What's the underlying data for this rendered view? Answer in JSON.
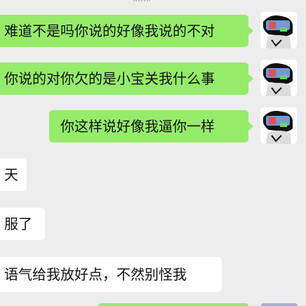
{
  "conversation": {
    "messages": [
      {
        "side": "out",
        "text": "难道不是吗你说的好像我说的不对"
      },
      {
        "side": "out",
        "text": "你说的对你欠的是小宝关我什么事"
      },
      {
        "side": "out",
        "text": "你这样说好像我逼你一样"
      },
      {
        "side": "in",
        "text": "天"
      },
      {
        "side": "in",
        "text": "服了"
      },
      {
        "side": "in",
        "text": "语气给我放好点，不然别怪我"
      }
    ]
  },
  "colors": {
    "background": "#ededed",
    "outgoing_bubble": "#95ec69",
    "incoming_bubble": "#ffffff"
  },
  "icons": {
    "avatar": "user-avatar-icon"
  }
}
